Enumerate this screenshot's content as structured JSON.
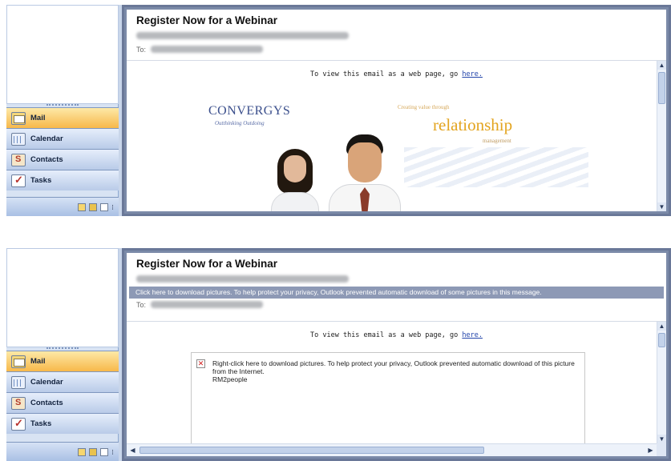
{
  "nav": {
    "items": [
      {
        "label": "Mail",
        "icon": "mail-icon"
      },
      {
        "label": "Calendar",
        "icon": "calendar-icon"
      },
      {
        "label": "Contacts",
        "icon": "contacts-icon"
      },
      {
        "label": "Tasks",
        "icon": "tasks-icon"
      }
    ],
    "active_item": "Mail"
  },
  "panels": [
    {
      "subject": "Register Now for a Webinar",
      "to_label": "To:",
      "view_note_prefix": "To view this email as a web page, go ",
      "view_note_link": "here.",
      "banner": {
        "logo": "CONVERGYS",
        "logo_tagline": "Outthinking Outdoing",
        "tag_small": "Creating value through",
        "tag_big": "relationship",
        "tag_sub": "management"
      }
    },
    {
      "subject": "Register Now for a Webinar",
      "infobar": "Click here to download pictures. To help protect your privacy, Outlook prevented automatic download of some pictures in this message.",
      "to_label": "To:",
      "view_note_prefix": "To view this email as a web page, go ",
      "view_note_link": "here.",
      "placeholder": {
        "line1": "Right-click here to download pictures. To help protect your privacy, Outlook prevented automatic download of this picture from the Internet.",
        "alt": "RM2people"
      }
    }
  ],
  "colors": {
    "active_nav": "#f7b84a",
    "infobar": "#8d99b5",
    "link": "#2244aa",
    "brand_orange": "#e3a41f"
  }
}
